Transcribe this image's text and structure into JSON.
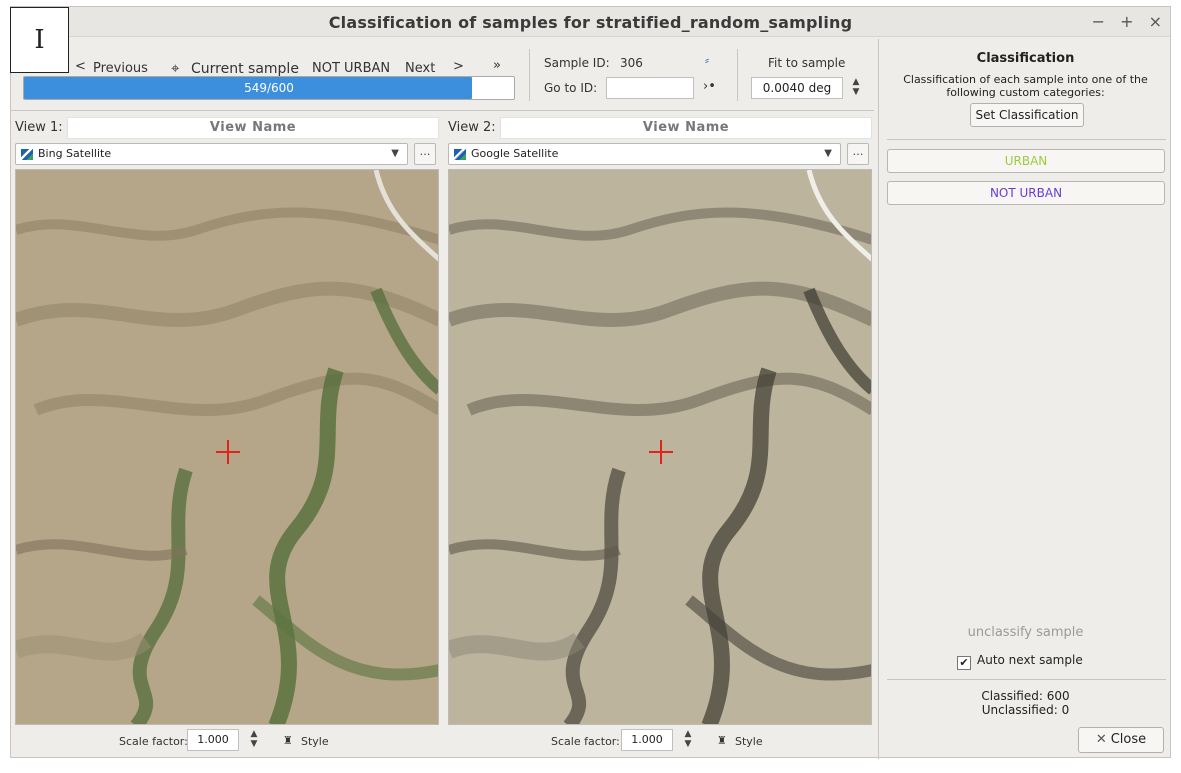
{
  "corner_label": "I",
  "window": {
    "title": "Classification of samples for stratified_random_sampling",
    "controls": [
      "−",
      "+",
      "×"
    ]
  },
  "nav": {
    "previous": "Previous",
    "current_sample": "Current sample",
    "status": "NOT URBAN",
    "next": "Next",
    "prev_chevron": "<",
    "next_chevron": ">",
    "last_chevron": "»"
  },
  "progress": {
    "text": "549/600",
    "value": 549,
    "max": 600
  },
  "sample": {
    "id_label": "Sample ID:",
    "id_value": "306",
    "goto_label": "Go to ID:",
    "goto_value": ""
  },
  "fit": {
    "label": "Fit to sample",
    "value": "0.0040 deg"
  },
  "view1": {
    "label": "View 1:",
    "name_placeholder": "View Name",
    "source": "Bing Satellite",
    "scale_label": "Scale factor:",
    "scale_value": "1.000",
    "style_label": "Style"
  },
  "view2": {
    "label": "View 2:",
    "name_placeholder": "View Name",
    "source": "Google Satellite",
    "scale_label": "Scale factor:",
    "scale_value": "1.000",
    "style_label": "Style"
  },
  "classification": {
    "title": "Classification",
    "description": "Classification of each sample into one of the following custom categories:",
    "set_button": "Set Classification",
    "categories": [
      {
        "label": "URBAN",
        "color": "#9ccc3c"
      },
      {
        "label": "NOT URBAN",
        "color": "#6a3cd6"
      }
    ],
    "unclassify": "unclassify sample",
    "auto_next": "Auto next sample",
    "auto_next_checked": true,
    "classified": "Classified: 600",
    "unclassified": "Unclassified: 0",
    "close_button": "Close"
  },
  "colors": {
    "accent": "#3c8fdc",
    "crosshair": "#e2231a"
  }
}
